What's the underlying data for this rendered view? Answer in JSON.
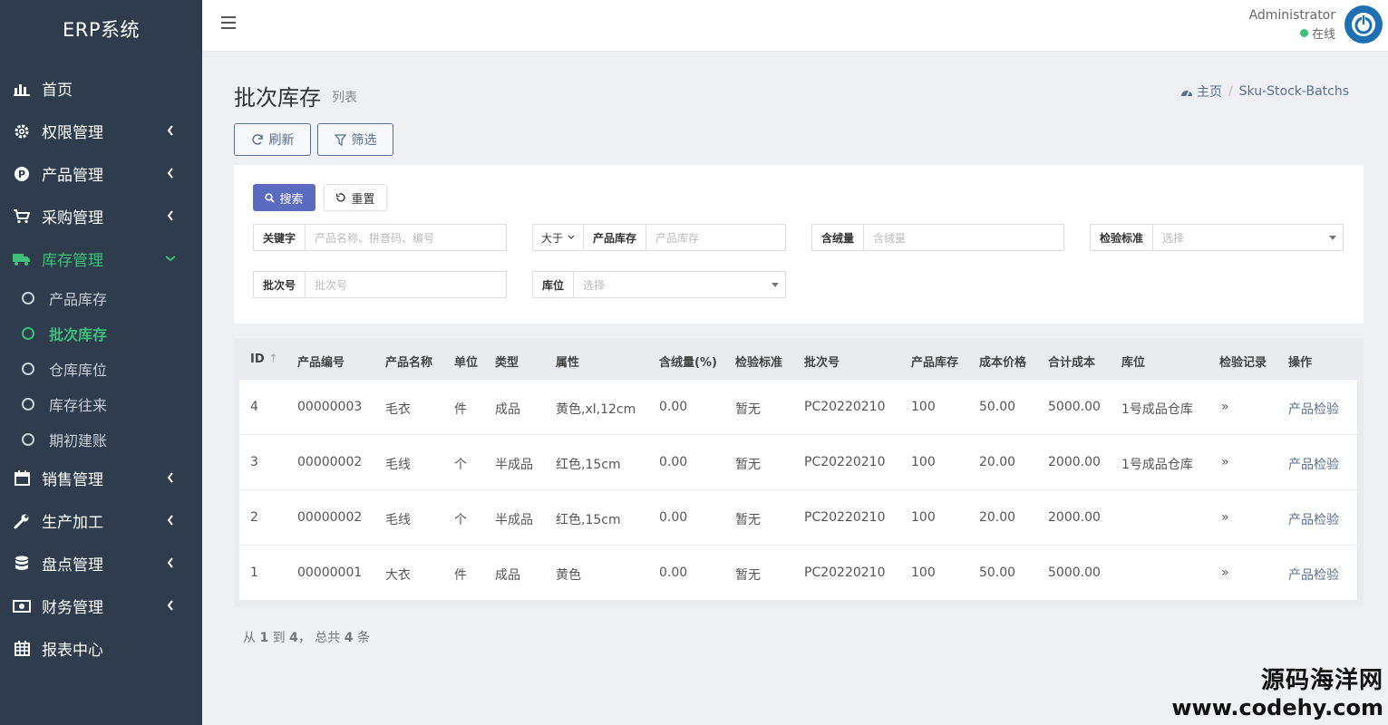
{
  "app": {
    "brand": "ERP系统"
  },
  "sidebar": {
    "items": [
      {
        "label": "首页",
        "icon": "bar-chart-icon",
        "has_children": false
      },
      {
        "label": "权限管理",
        "icon": "gear-icon",
        "has_children": true
      },
      {
        "label": "产品管理",
        "icon": "product-p-icon",
        "has_children": true
      },
      {
        "label": "采购管理",
        "icon": "cart-icon",
        "has_children": true
      },
      {
        "label": "库存管理",
        "icon": "truck-icon",
        "has_children": true,
        "expanded": true
      },
      {
        "label": "销售管理",
        "icon": "calendar-icon",
        "has_children": true
      },
      {
        "label": "生产加工",
        "icon": "wrench-icon",
        "has_children": true
      },
      {
        "label": "盘点管理",
        "icon": "database-icon",
        "has_children": true
      },
      {
        "label": "财务管理",
        "icon": "money-icon",
        "has_children": true
      },
      {
        "label": "报表中心",
        "icon": "table-icon",
        "has_children": false
      }
    ],
    "inventory_sub": [
      "产品库存",
      "批次库存",
      "仓库库位",
      "库存往来",
      "期初建账"
    ],
    "active_color": "#3fbf7a"
  },
  "topbar": {
    "username": "Administrator",
    "status": "在线"
  },
  "page": {
    "title": "批次库存",
    "subtitle": "列表",
    "breadcrumb_home": "主页",
    "breadcrumb_current": "Sku-Stock-Batchs"
  },
  "toolbar": {
    "refresh": "刷新",
    "filter": "筛选"
  },
  "filters": {
    "search_btn": "搜索",
    "reset_btn": "重置",
    "keyword_label": "关键字",
    "keyword_placeholder": "产品名称、拼音码、编号",
    "op_value": "大于",
    "stock_label": "产品库存",
    "stock_placeholder": "产品库存",
    "wool_label": "含绒量",
    "wool_placeholder": "含绒量",
    "standard_label": "检验标准",
    "standard_placeholder": "选择",
    "batch_label": "批次号",
    "batch_placeholder": "批次号",
    "location_label": "库位",
    "location_placeholder": "选择"
  },
  "table": {
    "columns": [
      "ID",
      "产品编号",
      "产品名称",
      "单位",
      "类型",
      "属性",
      "含绒量(%)",
      "检验标准",
      "批次号",
      "产品库存",
      "成本价格",
      "合计成本",
      "库位",
      "检验记录",
      "操作"
    ],
    "rows": [
      [
        "4",
        "00000003",
        "毛衣",
        "件",
        "成品",
        "黄色,xl,12cm",
        "0.00",
        "暂无",
        "PC20220210",
        "100",
        "50.00",
        "5000.00",
        "1号成品仓库",
        "»",
        "产品检验"
      ],
      [
        "3",
        "00000002",
        "毛线",
        "个",
        "半成品",
        "红色,15cm",
        "0.00",
        "暂无",
        "PC20220210",
        "100",
        "20.00",
        "2000.00",
        "1号成品仓库",
        "»",
        "产品检验"
      ],
      [
        "2",
        "00000002",
        "毛线",
        "个",
        "半成品",
        "红色,15cm",
        "0.00",
        "暂无",
        "PC20220210",
        "100",
        "20.00",
        "2000.00",
        "",
        "»",
        "产品检验"
      ],
      [
        "1",
        "00000001",
        "大衣",
        "件",
        "成品",
        "黄色",
        "0.00",
        "暂无",
        "PC20220210",
        "100",
        "50.00",
        "5000.00",
        "",
        "»",
        "产品检验"
      ]
    ]
  },
  "pager": {
    "from_text": "从",
    "from": "1",
    "to_text": "到",
    "to": "4",
    "total_text": "，  总共",
    "total": "4",
    "unit": "条"
  },
  "watermark": {
    "line1": "源码海洋网",
    "line2": "www.codehy.com"
  }
}
